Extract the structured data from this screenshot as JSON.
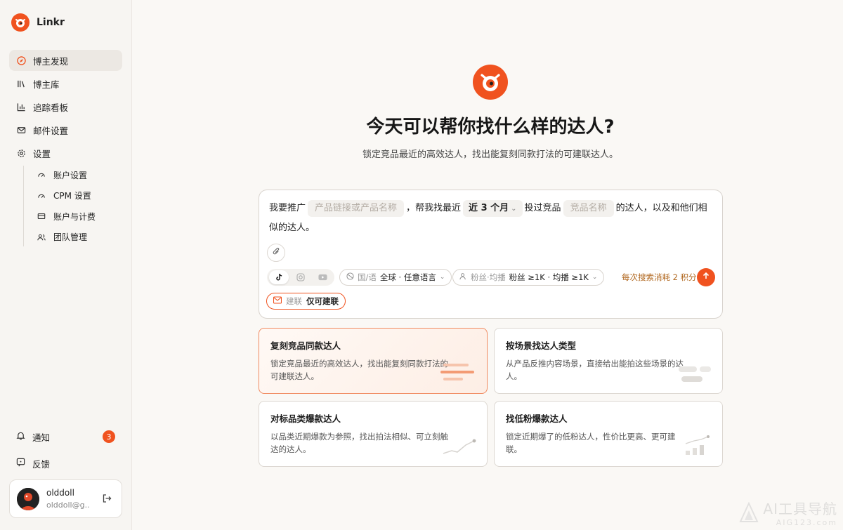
{
  "brand": {
    "name": "Linkr"
  },
  "nav": {
    "discover": "博主发现",
    "library": "博主库",
    "tracking": "追踪看板",
    "email": "邮件设置",
    "settings": "设置",
    "sub": {
      "account": "账户设置",
      "cpm": "CPM 设置",
      "billing": "账户与计费",
      "team": "团队管理"
    }
  },
  "bottom": {
    "notifications": "通知",
    "notification_count": "3",
    "feedback": "反馈"
  },
  "user": {
    "name": "olddoll",
    "email": "olddoll@g..."
  },
  "hero": {
    "title": "今天可以帮你找什么样的达人?",
    "subtitle": "锁定竞品最近的高效达人，找出能复刻同款打法的可建联达人。"
  },
  "composer": {
    "part1": "我要推广",
    "product_placeholder": "产品链接或产品名称",
    "part2": "，帮我找最近",
    "period": "近 3 个月",
    "part3": "投过竞品",
    "competitor_placeholder": "竞品名称",
    "part4": "的达人，以及和他们相似的达人。",
    "region_key": "国/语",
    "region_value": "全球 · 任意语言",
    "fans_key": "粉丝·均播",
    "fans_value": "粉丝 ≥1K · 均播 ≥1K",
    "cost": "每次搜索消耗 2 积分",
    "contact_key": "建联",
    "contact_value": "仅可建联"
  },
  "cards": [
    {
      "title": "复刻竞品同款达人",
      "desc": "锁定竞品最近的高效达人，找出能复刻同款打法的可建联达人。"
    },
    {
      "title": "按场景找达人类型",
      "desc": "从产品反推内容场景，直接给出能拍这些场景的达人。"
    },
    {
      "title": "对标品类爆款达人",
      "desc": "以品类近期爆款为参照，找出拍法相似、可立刻触达的达人。"
    },
    {
      "title": "找低粉爆款达人",
      "desc": "锁定近期爆了的低粉达人，性价比更高、更可建联。"
    }
  ],
  "watermark": {
    "line1": "AI工具导航",
    "line2": "AIG123.com"
  },
  "colors": {
    "accent": "#f0521f",
    "cost_text": "#b0661d"
  },
  "icons": [
    "compass-icon",
    "library-icon",
    "bar-chart-icon",
    "mail-icon",
    "gear-icon",
    "gauge-icon",
    "card-icon",
    "users-icon",
    "bell-icon",
    "feedback-icon",
    "logout-icon",
    "paperclip-icon",
    "tiktok-icon",
    "instagram-icon",
    "youtube-icon",
    "globe-icon",
    "user-icon",
    "arrow-up-icon"
  ]
}
